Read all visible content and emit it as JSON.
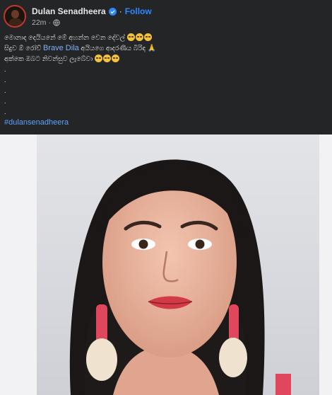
{
  "post": {
    "author": "Dulan Senadheera",
    "follow_label": "Follow",
    "separator": "·",
    "timestamp": "22m",
    "visibility_icon": "globe-icon",
    "verified_icon": "verified-badge-icon"
  },
  "body": {
    "line1": "මොනාද දෙයියනේ මේ අහන්න වෙන දේවල්",
    "line2_prefix": "සිදුව ඕ රෝව්",
    "line2_mention": "Brave Dila",
    "line2_suffix": "අයියගෙ ආදරණීය බිරිඳ",
    "line3": "අක්කෙ ඔබට නිවන්සුව ලැබේවා",
    "dots": [
      ".",
      ".",
      ".",
      ".",
      "."
    ],
    "hashtag": "#dulansenadheera"
  },
  "colors": {
    "background": "#242526",
    "accent": "#2d88ff",
    "text": "#e4e6eb",
    "muted": "#b0b3b8"
  }
}
